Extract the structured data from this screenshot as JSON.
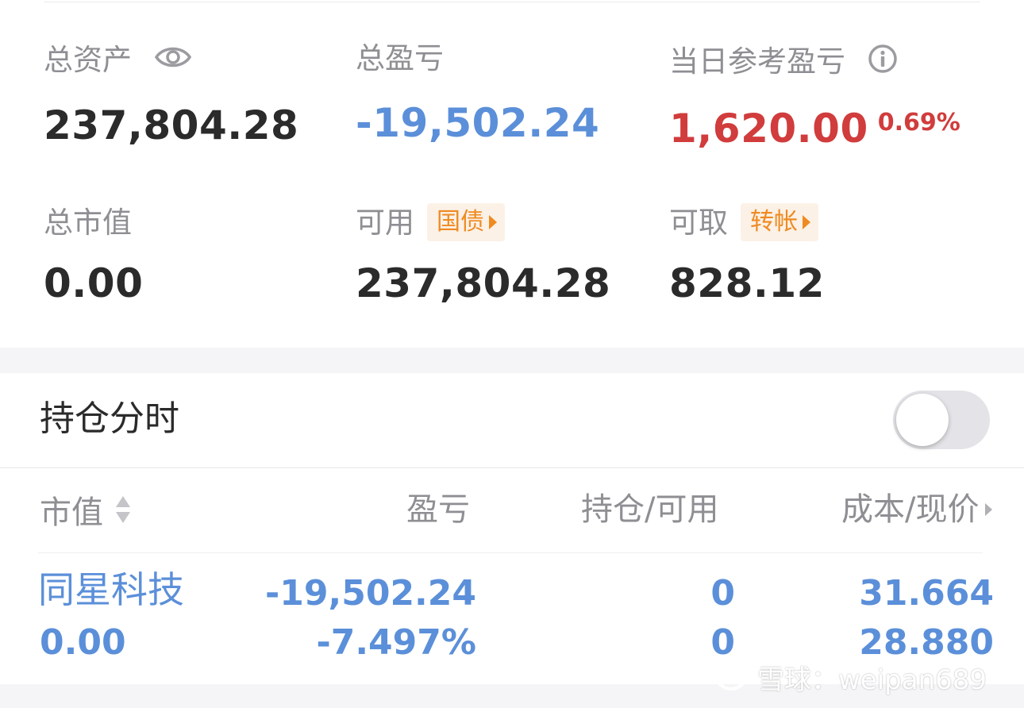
{
  "summary": {
    "total_assets_label": "总资产",
    "total_assets_value": "237,804.28",
    "total_pl_label": "总盈亏",
    "total_pl_value": "-19,502.24",
    "daily_ref_pl_label": "当日参考盈亏",
    "daily_ref_pl_value": "1,620.00",
    "daily_ref_pl_pct": "0.69%",
    "market_value_label": "总市值",
    "market_value_value": "0.00",
    "available_label": "可用",
    "available_chip": "国债",
    "available_value": "237,804.28",
    "withdrawable_label": "可取",
    "withdrawable_chip": "转帐",
    "withdrawable_value": "828.12"
  },
  "positions_toggle": {
    "label": "持仓分时",
    "enabled": false
  },
  "table": {
    "headers": {
      "market_value": "市值",
      "pl": "盈亏",
      "holding_available": "持仓/可用",
      "cost_price": "成本/现价"
    },
    "rows": [
      {
        "name": "同星科技",
        "market_value": "0.00",
        "pl": "-19,502.24",
        "pl_pct": "-7.497%",
        "holding": "0",
        "available": "0",
        "cost": "31.664",
        "price": "28.880"
      }
    ]
  },
  "watermark": "雪球：weipan689",
  "colors": {
    "loss_blue": "#5b8fd9",
    "gain_red": "#d13c3c",
    "chip_orange": "#ef8a21"
  }
}
